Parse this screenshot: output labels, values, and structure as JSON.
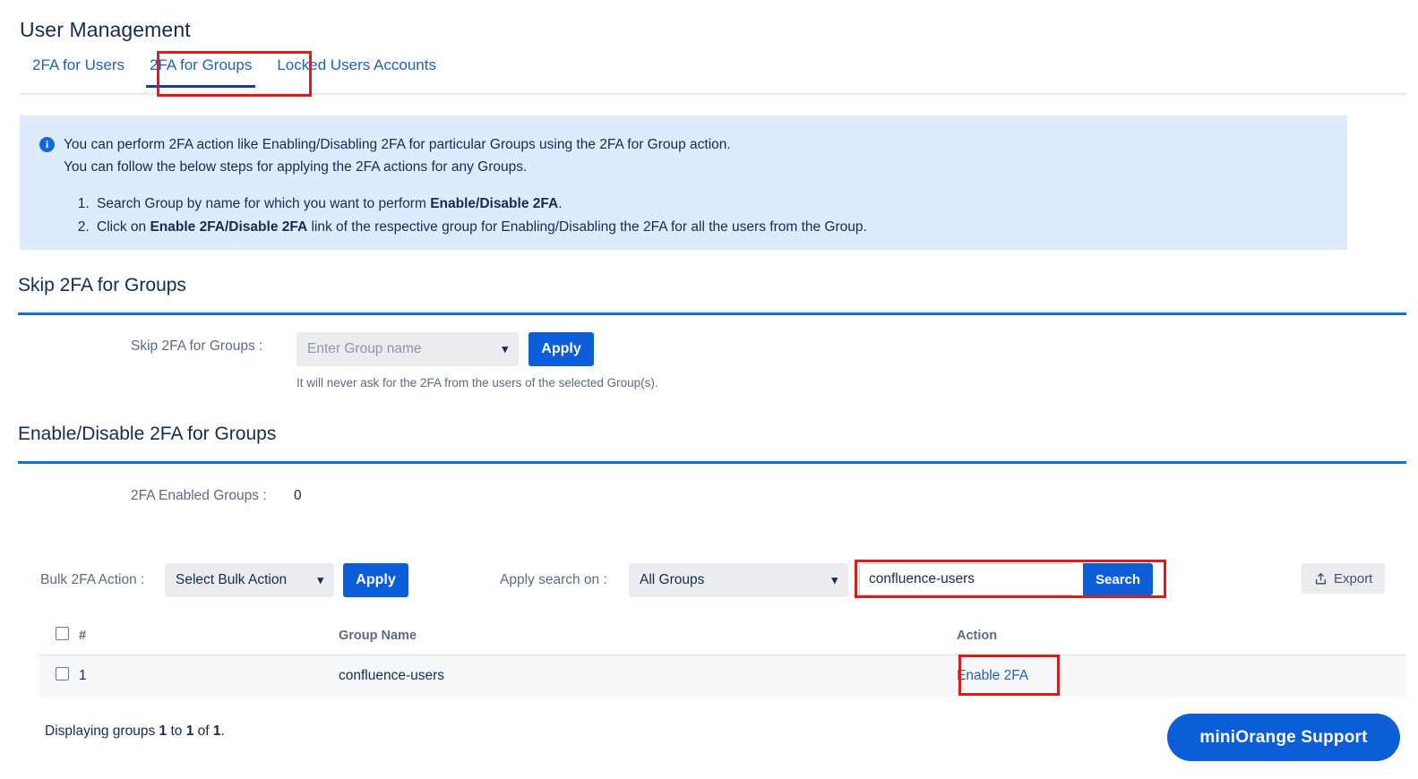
{
  "page": {
    "title": "User Management"
  },
  "tabs": [
    {
      "label": "2FA for Users",
      "active": false
    },
    {
      "label": "2FA for Groups",
      "active": true
    },
    {
      "label": "Locked Users Accounts",
      "active": false
    }
  ],
  "info_banner": {
    "icon": "info-circle-icon",
    "line1": "You can perform 2FA action like Enabling/Disabling 2FA for particular Groups using the 2FA for Group action.",
    "line2": "You can follow the below steps for applying the 2FA actions for any Groups.",
    "step1_prefix": "Search Group by name for which you want to perform ",
    "step1_bold": "Enable/Disable 2FA",
    "step1_suffix": ".",
    "step2_prefix": "Click on ",
    "step2_bold": "Enable 2FA/Disable 2FA",
    "step2_suffix": " link of the respective group for Enabling/Disabling the 2FA for all the users from the Group."
  },
  "skip_section": {
    "heading": "Skip 2FA for Groups",
    "field_label": "Skip 2FA for Groups :",
    "select_placeholder": "Enter Group name",
    "select_value": "",
    "apply_label": "Apply",
    "helper": "It will never ask for the 2FA from the users of the selected Group(s)."
  },
  "enable_section": {
    "heading": "Enable/Disable 2FA for Groups",
    "enabled_label": "2FA Enabled Groups :",
    "enabled_count": "0"
  },
  "toolbar": {
    "bulk_label": "Bulk 2FA Action :",
    "bulk_value": "Select Bulk Action",
    "bulk_apply_label": "Apply",
    "search_on_label": "Apply search on :",
    "search_on_value": "All Groups",
    "search_value": "confluence-users",
    "search_placeholder": "",
    "search_button_label": "Search",
    "export_label": "Export"
  },
  "table": {
    "columns": [
      "#",
      "Group Name",
      "Action"
    ],
    "rows": [
      {
        "num": "1",
        "group_name": "confluence-users",
        "action": "Enable 2FA"
      }
    ]
  },
  "footer": {
    "prefix": "Displaying groups ",
    "from": "1",
    "mid1": " to ",
    "to": "1",
    "mid2": " of ",
    "total": "1",
    "suffix": "."
  },
  "support": {
    "label": "miniOrange Support"
  },
  "colors": {
    "primary_blue": "#0b5ed7",
    "link_blue": "#2060c0",
    "banner_bg": "#deebff",
    "highlight_red": "#e01b1b",
    "rule_blue": "#1470d6",
    "field_bg": "#ebecf0"
  }
}
